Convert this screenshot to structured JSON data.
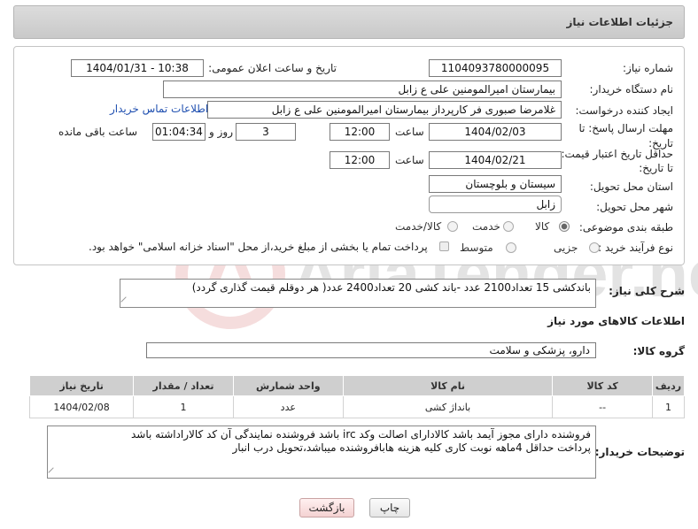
{
  "header": {
    "title": "جزئیات اطلاعات نیاز"
  },
  "form": {
    "need_number_label": "شماره نیاز:",
    "need_number": "1104093780000095",
    "announce_label": "تاریخ و ساعت اعلان عمومی:",
    "announce_value": "1404/01/31 - 10:38",
    "buyer_org_label": "نام دستگاه خریدار:",
    "buyer_org": "بیمارستان امیرالمومنین علی  ع  زابل",
    "creator_label": "ایجاد کننده درخواست:",
    "creator": "غلامرضا صبوری فر کارپرداز بیمارستان امیرالمومنین علی  ع  زابل",
    "contact_link": "اطلاعات تماس خریدار",
    "reply_deadline_label": "مهلت ارسال پاسخ: تا تاریخ:",
    "reply_date": "1404/02/03",
    "time_label": "ساعت",
    "reply_time": "12:00",
    "days_value": "3",
    "days_label": "روز و",
    "remaining_time": "01:04:34",
    "remaining_label": "ساعت باقی مانده",
    "price_validity_label": "حداقل تاریخ اعتبار قیمت: تا تاریخ:",
    "validity_date": "1404/02/21",
    "validity_time": "12:00",
    "province_label": "استان محل تحویل:",
    "province": "سیستان و بلوچستان",
    "city_label": "شهر محل تحویل:",
    "city": "زابل",
    "category_label": "طبقه بندی موضوعی:",
    "category_options": [
      "کالا",
      "خدمت",
      "کالا/خدمت"
    ],
    "process_label": "نوع فرآیند خرید :",
    "process_options": [
      "جزیی",
      "متوسط"
    ],
    "payment_note": "پرداخت تمام یا بخشی از مبلغ خرید،از محل \"اسناد خزانه اسلامی\" خواهد بود."
  },
  "description": {
    "label": "شرح کلی نیاز:",
    "text": "باندکشی 15 تعداد2100 عدد -باند کشی 20 تعداد2400 عدد( هر دوقلم قیمت گذاری گردد)"
  },
  "goods": {
    "section_title": "اطلاعات کالاهای مورد نیاز",
    "group_label": "گروه کالا:",
    "group_value": "دارو، پزشکی و سلامت",
    "columns": [
      "ردیف",
      "کد کالا",
      "نام کالا",
      "واحد شمارش",
      "تعداد / مقدار",
      "تاریخ نیاز"
    ],
    "rows": [
      {
        "index": "1",
        "code": "--",
        "name": "بانداژ کشی",
        "unit": "عدد",
        "qty": "1",
        "date": "1404/02/08"
      }
    ]
  },
  "buyer_notes": {
    "label": "توضیحات خریدار:",
    "line1": "فروشنده دارای مجوز آیمد باشد کالادارای اصالت وکد irc باشد فروشنده نمایندگی آن کد کالاراداشته باشد",
    "line2": "پرداخت حداقل 4ماهه نوبت کاری کلیه هزینه هابافروشنده میباشد،تحویل درب انبار"
  },
  "buttons": {
    "print": "چاپ",
    "back": "بازگشت"
  },
  "watermark": {
    "text": "AriaTender.net"
  }
}
